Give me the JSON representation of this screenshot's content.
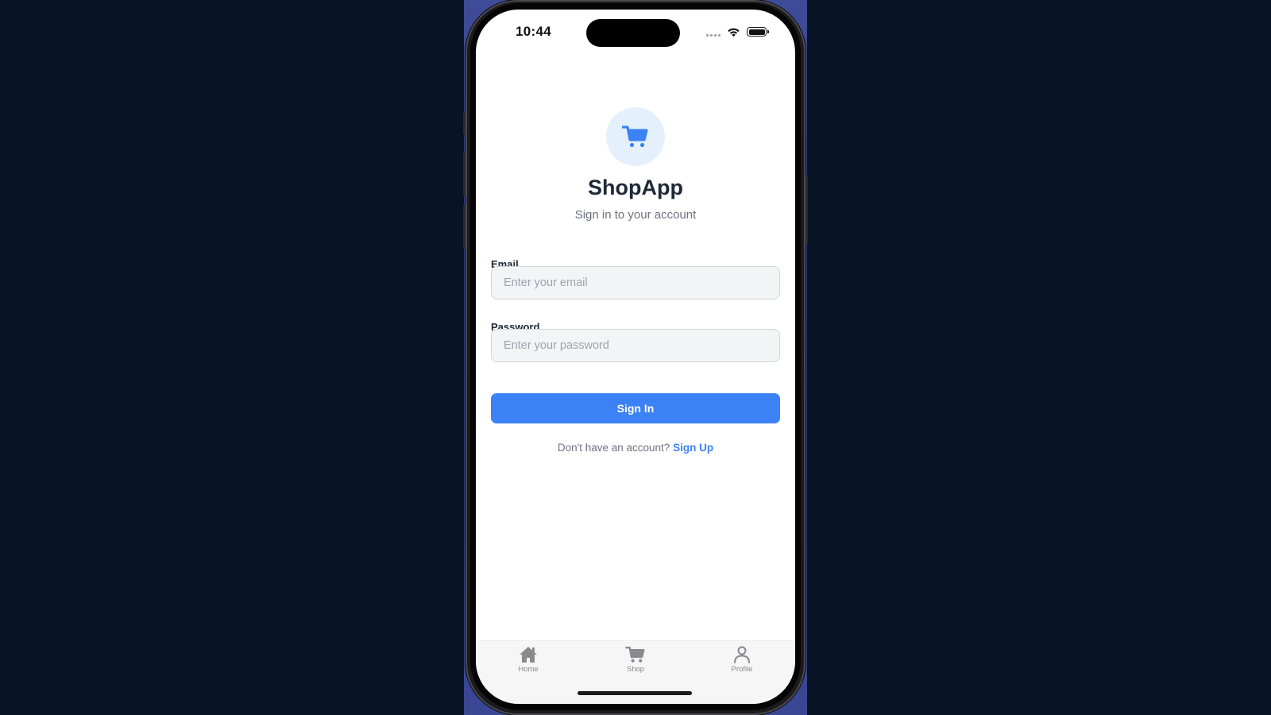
{
  "status_bar": {
    "time": "10:44"
  },
  "branding": {
    "icon": "shopping-cart-icon",
    "app_name": "ShopApp",
    "subtitle": "Sign in to your account"
  },
  "form": {
    "email": {
      "label": "Email",
      "value": "",
      "placeholder": "Enter your email"
    },
    "password": {
      "label": "Password",
      "value": "",
      "placeholder": "Enter your password"
    },
    "submit_label": "Sign In",
    "signup_prompt": "Don't have an account?",
    "signup_link": "Sign Up"
  },
  "tab_bar": {
    "tabs": [
      {
        "label": "Home",
        "icon": "home-icon"
      },
      {
        "label": "Shop",
        "icon": "cart-icon"
      },
      {
        "label": "Profile",
        "icon": "person-icon"
      }
    ]
  },
  "colors": {
    "accent": "#3b82f6",
    "logo_background": "#e5f0fd",
    "title_text": "#1f2937",
    "muted_text": "#6b7280",
    "tab_icon": "#8a8a8e",
    "page_background": "#081326"
  }
}
